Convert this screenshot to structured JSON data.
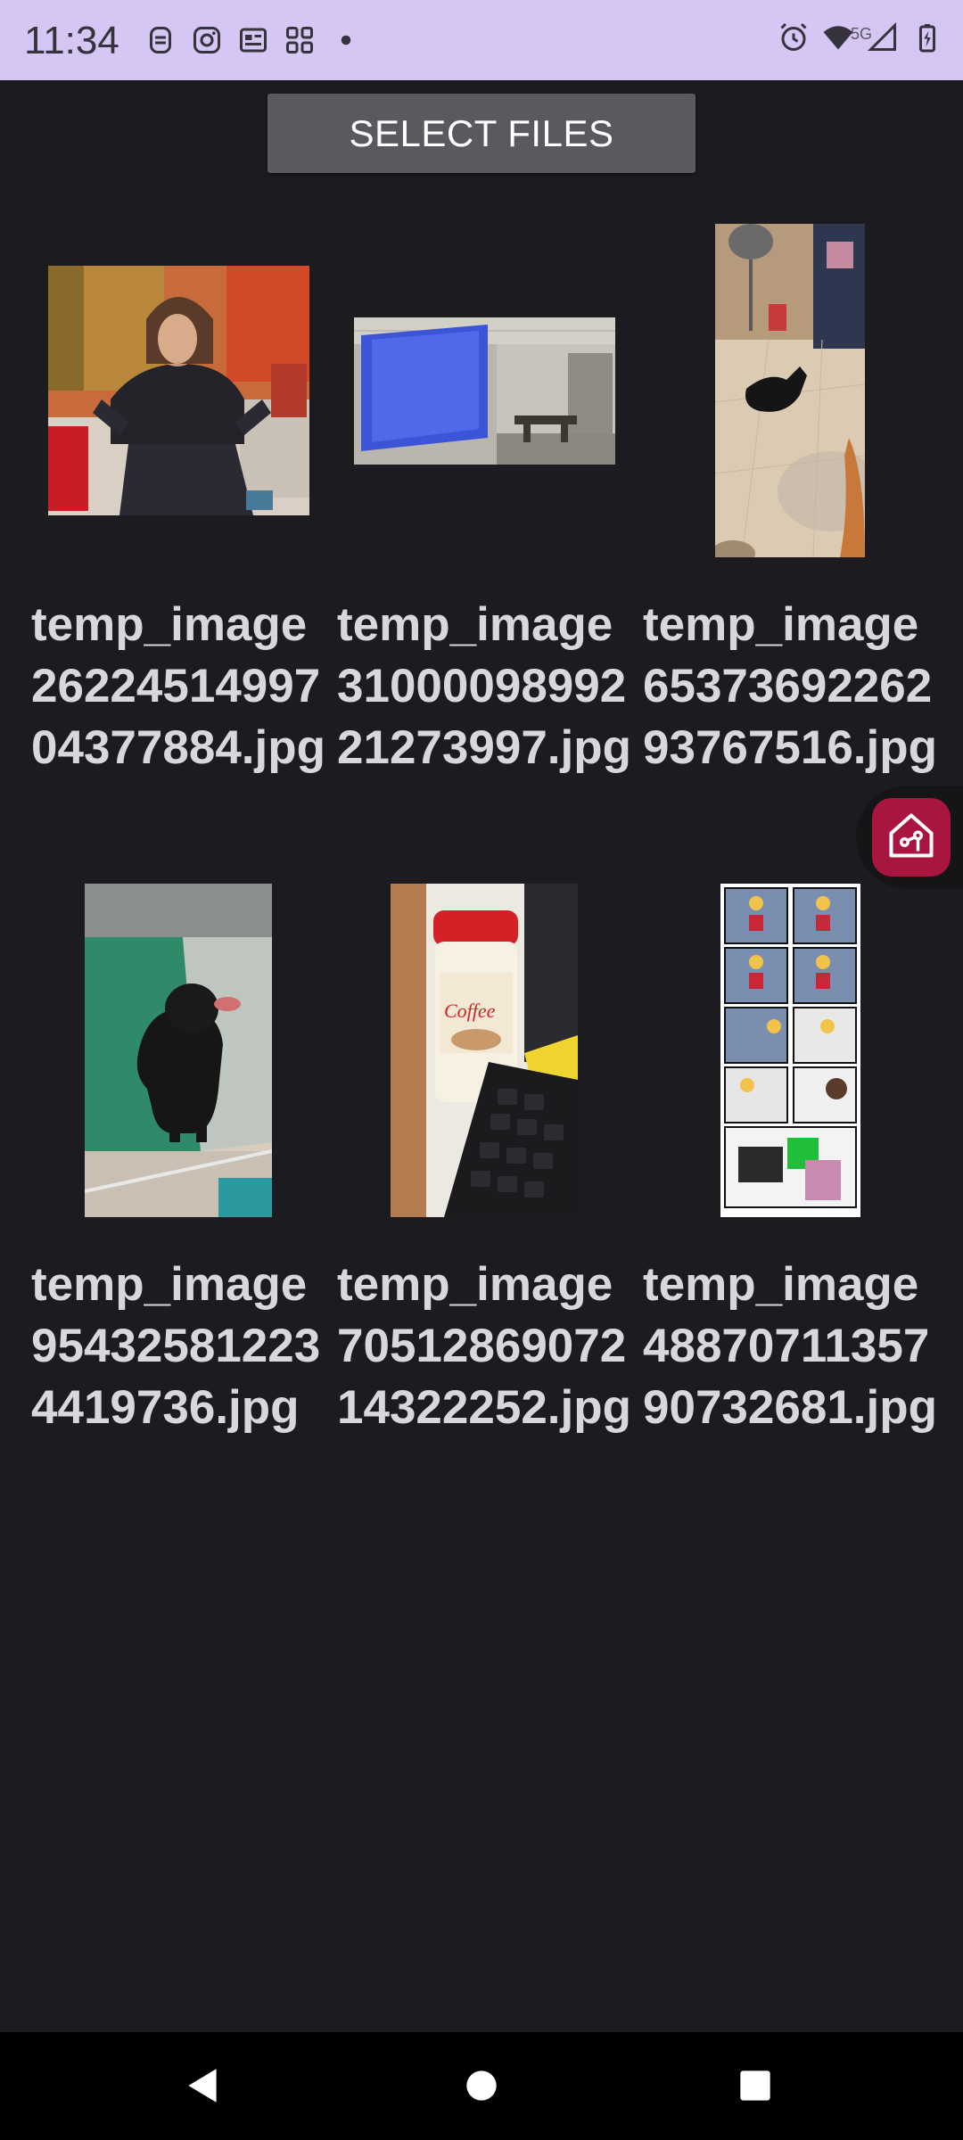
{
  "status_bar": {
    "time": "11:34",
    "network_label": "5G",
    "left_icons": [
      "face-id-icon",
      "instagram-icon",
      "news-icon",
      "widgets-icon",
      "dot-icon"
    ],
    "right_icons": [
      "alarm-icon",
      "wifi-icon",
      "signal-icon",
      "battery-icon"
    ]
  },
  "toolbar": {
    "select_files_label": "SELECT FILES"
  },
  "files": [
    {
      "name": "temp_image2622451499704377884.jpg",
      "subject": "woman on sofa"
    },
    {
      "name": "temp_image3100009899221273997.jpg",
      "subject": "meeting room"
    },
    {
      "name": "temp_image6537369226293767516.jpg",
      "subject": "black dog on tiles"
    },
    {
      "name": "temp_image954325812234419736.jpg",
      "subject": "black dog sitting"
    },
    {
      "name": "temp_image7051286907214322252.jpg",
      "subject": "coffee mate and keyboard"
    },
    {
      "name": "temp_image4887071135790732681.jpg",
      "subject": "comic strip"
    }
  ],
  "floating_button": {
    "icon": "home-icon",
    "color": "#a8153f"
  },
  "nav_bar": {
    "icons": [
      "back-icon",
      "home-circle-icon",
      "recents-icon"
    ]
  },
  "colors": {
    "status_bar": "#d5c6f4",
    "background": "#1c1b20",
    "button": "#5a595d",
    "caption": "#d8d8dc"
  }
}
